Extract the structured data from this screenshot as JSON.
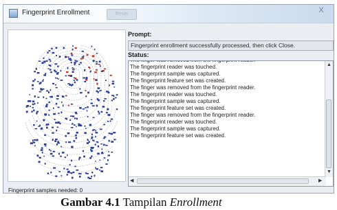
{
  "window": {
    "title": "Fingerprint Enrollment",
    "ghost_tab": "Reset",
    "close_glyph": "X"
  },
  "prompt": {
    "label": "Prompt:",
    "text": "Fingerprint enrollment successfully processed, then click Close."
  },
  "status": {
    "label": "Status:",
    "lines": [
      "The fingerprint reader was touched.",
      "The fingerprint sample was captured.",
      "The fingerprint feature set was created.",
      "The finger was removed from the fingerprint reader.",
      "The fingerprint reader was touched.",
      "The fingerprint sample was captured.",
      "The fingerprint feature set was created.",
      "The finger was removed from the fingerprint reader.",
      "The fingerprint reader was touched.",
      "The fingerprint sample was captured.",
      "The fingerprint feature set was created."
    ]
  },
  "footer": {
    "samples_needed": "Fingerprint samples needed: 0"
  },
  "caption": {
    "prefix": "Gambar 4.1",
    "text": "Tampilan",
    "emphasis": "Enrollment"
  },
  "icons": {
    "app": "fingerprint-app-icon",
    "close": "close-icon",
    "scroll_up": "scroll-up-arrow-icon",
    "scroll_down": "scroll-down-arrow-icon",
    "scroll_left": "scroll-left-arrow-icon",
    "scroll_right": "scroll-right-arrow-icon"
  },
  "colors": {
    "minutiae_blue": "#2b3f9a",
    "minutiae_red": "#c0392b",
    "ridge_gray": "#8a8f96"
  }
}
